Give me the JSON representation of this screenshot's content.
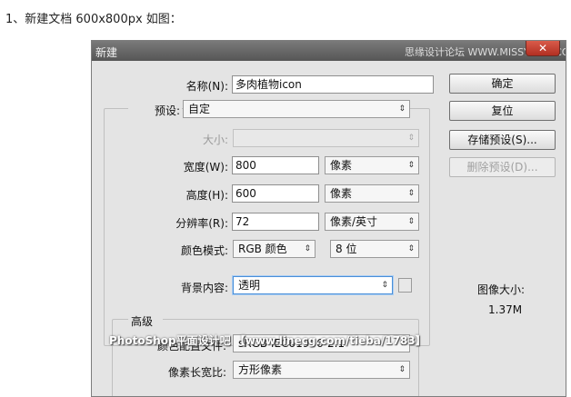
{
  "caption": "1、新建文档 600x800px 如图：",
  "dialog": {
    "title": "新建",
    "watermark_top": "思缘设计论坛 WWW.MISSYUAN.COM",
    "close_glyph": "✕",
    "name": {
      "label": "名称(N):",
      "value": "多肉植物icon"
    },
    "preset": {
      "label": "预设:",
      "value": "自定"
    },
    "size": {
      "label": "大小:",
      "value": ""
    },
    "width": {
      "label": "宽度(W):",
      "value": "800",
      "unit": "像素"
    },
    "height": {
      "label": "高度(H):",
      "value": "600",
      "unit": "像素"
    },
    "resolution": {
      "label": "分辨率(R):",
      "value": "72",
      "unit": "像素/英寸"
    },
    "color_mode": {
      "label": "颜色模式:",
      "mode": "RGB 颜色",
      "depth": "8 位"
    },
    "background": {
      "label": "背景内容:",
      "value": "透明"
    },
    "advanced": {
      "title": "高级",
      "color_profile": {
        "label": "颜色配置文件:",
        "value": "sRGB IEC61966-2.1"
      },
      "pixel_aspect": {
        "label": "像素长宽比:",
        "value": "方形像素"
      }
    },
    "buttons": {
      "ok": "确定",
      "reset": "复位",
      "save_preset": "存储预设(S)...",
      "delete_preset": "删除预设(D)..."
    },
    "image_size": {
      "label": "图像大小:",
      "value": "1.37M"
    },
    "watermark_bottom": "PhotoShop平面设计吧 【www.linecg.com/tieba/1783】"
  },
  "icons": {
    "dropdown": "⇕"
  }
}
